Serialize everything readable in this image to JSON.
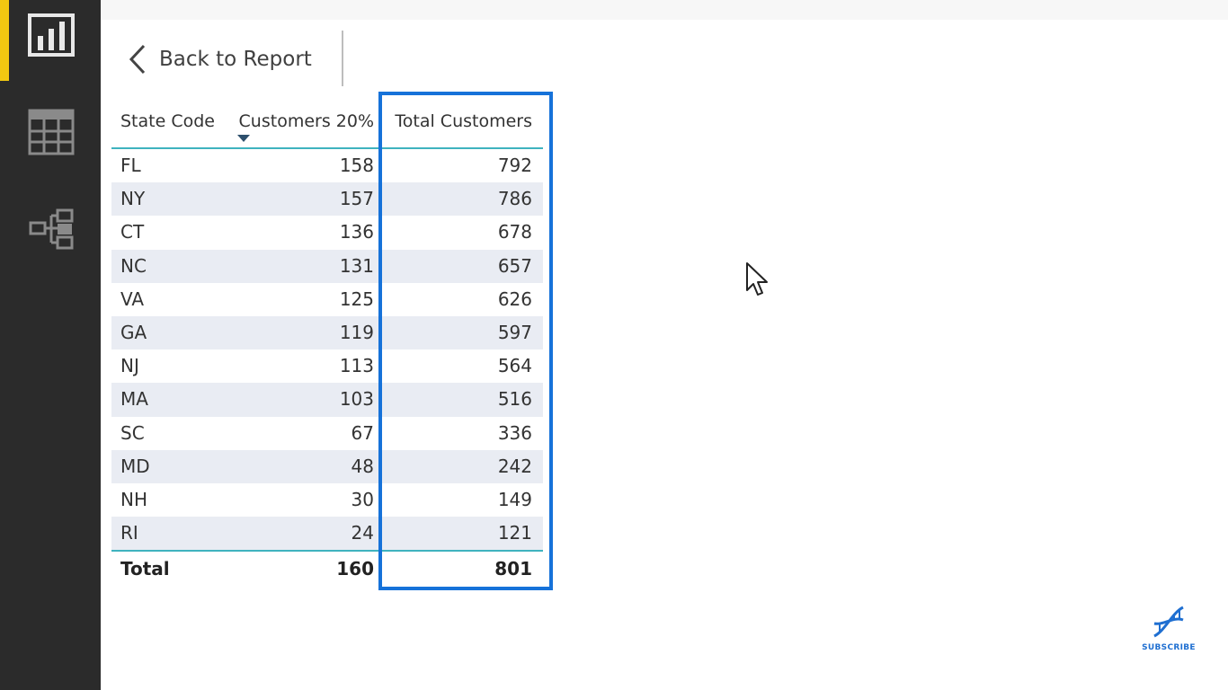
{
  "nav": {
    "items": [
      {
        "name": "report-view",
        "icon": "bar-chart-icon",
        "active": true
      },
      {
        "name": "data-view",
        "icon": "table-grid-icon",
        "active": false
      },
      {
        "name": "model-view",
        "icon": "relationships-icon",
        "active": false
      }
    ],
    "accent_color": "#f2c811"
  },
  "back": {
    "label": "Back to Report",
    "icon": "chevron-left-icon"
  },
  "table": {
    "headers": {
      "state": "State Code",
      "customers20": "Customers 20%",
      "total": "Total Customers"
    },
    "sort": {
      "column": "customers20",
      "direction": "descending"
    },
    "rows": [
      {
        "state": "FL",
        "customers20": "158",
        "total": "792"
      },
      {
        "state": "NY",
        "customers20": "157",
        "total": "786"
      },
      {
        "state": "CT",
        "customers20": "136",
        "total": "678"
      },
      {
        "state": "NC",
        "customers20": "131",
        "total": "657"
      },
      {
        "state": "VA",
        "customers20": "125",
        "total": "626"
      },
      {
        "state": "GA",
        "customers20": "119",
        "total": "597"
      },
      {
        "state": "NJ",
        "customers20": "113",
        "total": "564"
      },
      {
        "state": "MA",
        "customers20": "103",
        "total": "516"
      },
      {
        "state": "SC",
        "customers20": "67",
        "total": "336"
      },
      {
        "state": "MD",
        "customers20": "48",
        "total": "242"
      },
      {
        "state": "NH",
        "customers20": "30",
        "total": "149"
      },
      {
        "state": "RI",
        "customers20": "24",
        "total": "121"
      }
    ],
    "total": {
      "label": "Total",
      "customers20": "160",
      "total": "801"
    },
    "highlight_color": "#1672d9",
    "rule_color": "#3fb3bf"
  },
  "subscribe": {
    "label": "SUBSCRIBE",
    "icon": "dna-icon"
  }
}
